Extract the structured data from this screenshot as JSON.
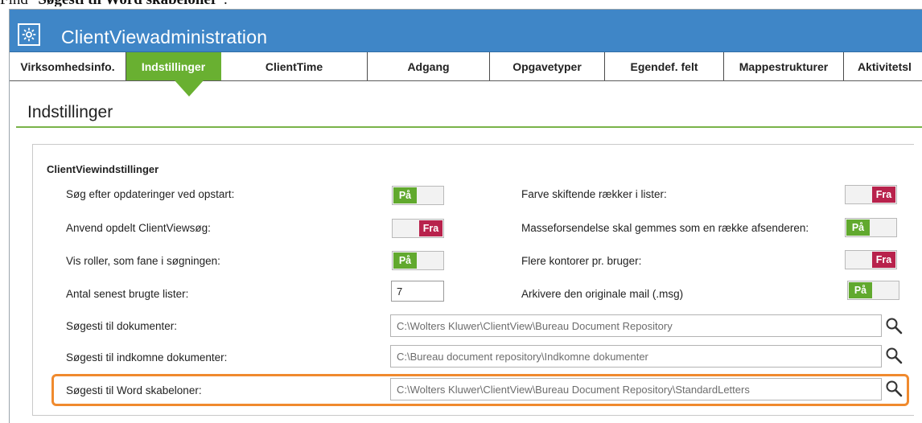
{
  "caption": {
    "prefix": "Find \"",
    "bold": "Søgesti til Word skabeloner",
    "suffix": "\"."
  },
  "app": {
    "title": "ClientViewadministration",
    "icon": "gear-icon"
  },
  "tabs": [
    {
      "label": "Virksomhedsinfo."
    },
    {
      "label": "Indstillinger",
      "active": true
    },
    {
      "label": "ClientTime"
    },
    {
      "label": "Adgang"
    },
    {
      "label": "Opgavetyper"
    },
    {
      "label": "Egendef. felt"
    },
    {
      "label": "Mappestrukturer"
    },
    {
      "label": "Aktivitetsl"
    }
  ],
  "page": {
    "title": "Indstillinger"
  },
  "group": {
    "title": "ClientViewindstillinger"
  },
  "settings": {
    "search_updates": {
      "label": "Søg efter opdateringer ved opstart:",
      "value": "På"
    },
    "split_search": {
      "label": "Anvend opdelt ClientViewsøg:",
      "value": "Fra"
    },
    "show_roles": {
      "label": "Vis roller, som fane i søgningen:",
      "value": "På"
    },
    "recent_lists": {
      "label": "Antal senest brugte lister:",
      "value": "7"
    },
    "alt_rows": {
      "label": "Farve skiftende rækker i lister:",
      "value": "Fra"
    },
    "mass_mail": {
      "label": "Masseforsendelse skal gemmes som en række afsenderen:",
      "value": "På"
    },
    "multi_office": {
      "label": "Flere kontorer pr. bruger:",
      "value": "Fra"
    },
    "archive_msg": {
      "label": "Arkivere den originale mail (.msg)",
      "value": "På"
    }
  },
  "paths": {
    "documents": {
      "label": "Søgesti til dokumenter:",
      "value": "C:\\Wolters Kluwer\\ClientView\\Bureau Document Repository"
    },
    "incoming": {
      "label": "Søgesti til indkomne dokumenter:",
      "value": "C:\\Bureau document repository\\Indkomne dokumenter"
    },
    "word_templates": {
      "label": "Søgesti til Word skabeloner:",
      "value": "C:\\Wolters Kluwer\\ClientView\\Bureau Document Repository\\StandardLetters"
    }
  },
  "colors": {
    "accent_green": "#69b031",
    "title_blue": "#3f86c7",
    "off_red": "#b8224c",
    "highlight_orange": "#f08a2e"
  }
}
